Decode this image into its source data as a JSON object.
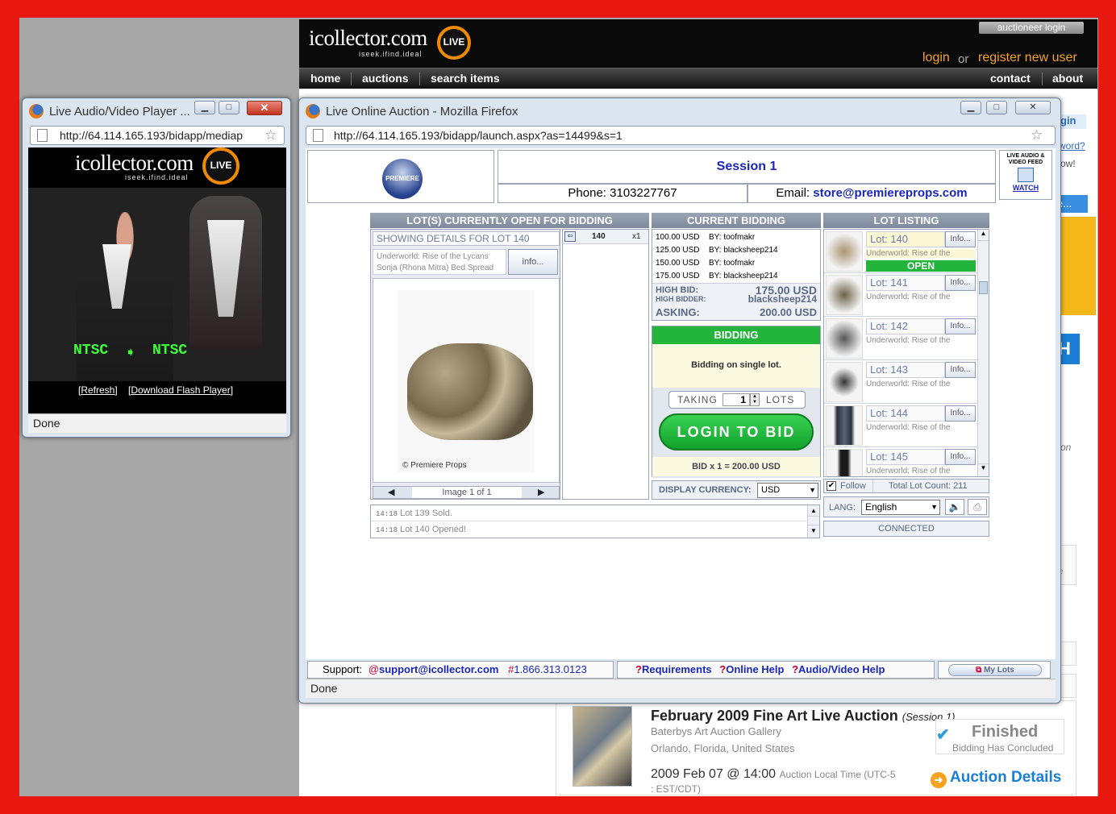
{
  "site": {
    "logo": "icollector.com",
    "logo_tagline": "iseek.ifind.ideal",
    "live_badge": "LIVE",
    "auctioneer_login": "auctioneer login",
    "login": "login",
    "or": "or",
    "register": "register new user",
    "nav": [
      "home",
      "auctions",
      "search items"
    ],
    "nav_right": [
      "contact",
      "about"
    ],
    "side_snippets": [
      "gin",
      "word?",
      "ow!",
      "e...",
      "H",
      "on",
      "le",
      "",
      ")",
      ""
    ],
    "listing": {
      "title": "February 2009 Fine Art Live Auction",
      "session": "(Session 1)",
      "gallery": "Baterbys Art Auction Gallery",
      "location": "Orlando, Florida, United States",
      "date": "2009 Feb 07 @ 14:00",
      "time_note": "Auction Local Time (UTC-5",
      "time_note2": ": EST/CDT)",
      "finished": "Finished",
      "concluded": "Bidding Has Concluded",
      "details": "Auction Details"
    }
  },
  "player_window": {
    "title": "Live Audio/Video Player ...",
    "url": "http://64.114.165.193/bidapp/mediap",
    "logo": "icollector.com",
    "logo_tagline": "iseek.ifind.ideal",
    "live_badge": "LIVE",
    "overlay_left": "NTSC",
    "overlay_right": "NTSC",
    "refresh": "[Refresh]",
    "download": "[Download Flash Player]",
    "status": "Done"
  },
  "auction_window": {
    "title": "Live Online Auction - Mozilla Firefox",
    "url": "http://64.114.165.193/bidapp/launch.aspx?as=14499&s=1",
    "status": "Done",
    "logo_text": "PREMIERE PROPS",
    "session": "Session 1",
    "phone_label": "Phone:",
    "phone": "3103227767",
    "email_label": "Email:",
    "email": "store@premiereprops.com",
    "feed_label": "LIVE AUDIO & VIDEO FEED",
    "watch": "WATCH",
    "open_lots": {
      "header": "LOT(S) CURRENTLY OPEN FOR BIDDING",
      "showing": "SHOWING DETAILS FOR LOT 140",
      "desc": "Underworld: Rise of the Lycans Sonja (Rhona Mitra) Bed Spread",
      "info": "info...",
      "lot_no": "140",
      "qty": "x1",
      "credit": "© Premiere Props",
      "image_nav": "Image 1 of 1"
    },
    "current_bidding": {
      "header": "CURRENT BIDDING",
      "bids": [
        {
          "amount": "100.00 USD",
          "by": "BY: toofmakr"
        },
        {
          "amount": "125.00 USD",
          "by": "BY: blacksheep214"
        },
        {
          "amount": "150.00 USD",
          "by": "BY: toofmakr"
        },
        {
          "amount": "175.00 USD",
          "by": "BY: blacksheep214"
        }
      ],
      "high_bid_label": "HIGH BID:",
      "high_bid": "175.00 USD",
      "high_bidder_label": "HIGH BIDDER:",
      "high_bidder": "blacksheep214",
      "asking_label": "ASKING:",
      "asking": "200.00 USD",
      "bidding_header": "BIDDING",
      "bidding_note": "Bidding on single lot.",
      "taking": "TAKING",
      "qty": "1",
      "lots": "LOTS",
      "login_button": "LOGIN TO BID",
      "bid_total": "BID x 1 = 200.00 USD",
      "currency_label": "DISPLAY CURRENCY:",
      "currency": "USD"
    },
    "lot_listing": {
      "header": "LOT LISTING",
      "open_tag": "OPEN",
      "lots": [
        {
          "label": "Lot: 140",
          "desc": "Underworld: Rise of the",
          "info": "Info..."
        },
        {
          "label": "Lot: 141",
          "desc": "Underworld: Rise of the",
          "info": "Info..."
        },
        {
          "label": "Lot: 142",
          "desc": "Underworld: Rise of the",
          "info": "Info..."
        },
        {
          "label": "Lot: 143",
          "desc": "Underworld: Rise of the",
          "info": "Info..."
        },
        {
          "label": "Lot: 144",
          "desc": "Underworld: Rise of the",
          "info": "Info..."
        },
        {
          "label": "Lot: 145",
          "desc": "Underworld: Rise of the",
          "info": "Info..."
        }
      ],
      "follow": "Follow",
      "total": "Total Lot Count: 211",
      "lang_label": "LANG:",
      "lang": "English",
      "connection": "CONNECTED"
    },
    "log": [
      {
        "time": "14:18",
        "msg": "Lot 139 Sold."
      },
      {
        "time": "14:18",
        "msg": "Lot 140 Opened!"
      }
    ],
    "footer": {
      "support": "Support:",
      "email": "support@icollector.com",
      "phone": "1.866.313.0123",
      "requirements": "Requirements",
      "online_help": "Online Help",
      "av_help": "Audio/Video Help",
      "my_lots": "My Lots"
    }
  }
}
